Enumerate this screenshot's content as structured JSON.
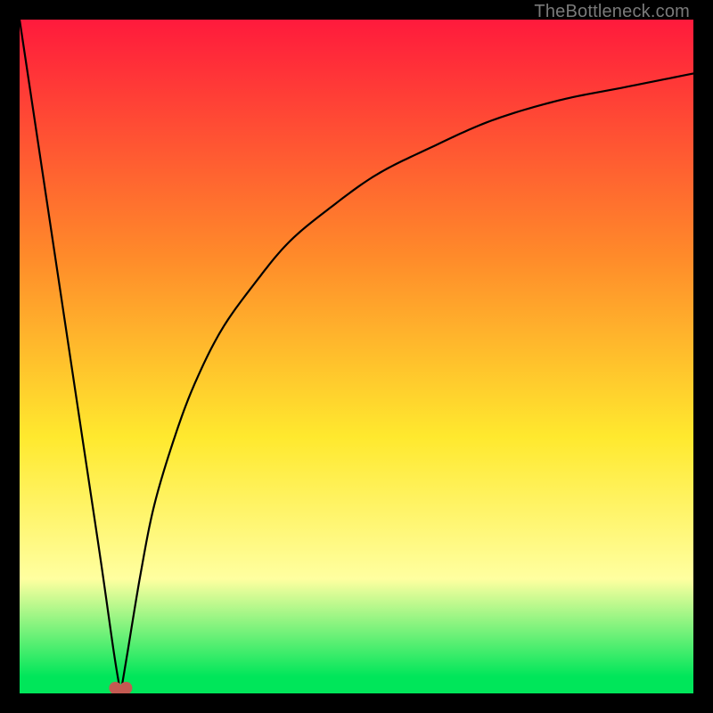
{
  "attribution": "TheBottleneck.com",
  "colors": {
    "red": "#ff1a3c",
    "orange": "#ff8a2a",
    "yellow": "#ffe92e",
    "paleyellow": "#ffffa0",
    "green": "#00e65a",
    "black": "#000000",
    "curve": "#000000",
    "minmarker": "#c45a52"
  },
  "chart_data": {
    "type": "line",
    "title": "",
    "xlabel": "",
    "ylabel": "",
    "xlim": [
      0,
      100
    ],
    "ylim": [
      0,
      100
    ],
    "x_at_min": 15,
    "y_at_min": 0,
    "y_at_x0": 100,
    "y_at_x100": 92,
    "series": [
      {
        "name": "bottleneck-curve",
        "x": [
          0,
          3,
          6,
          9,
          12,
          14,
          15,
          16,
          18,
          20,
          23,
          26,
          30,
          35,
          40,
          46,
          53,
          61,
          70,
          80,
          90,
          100
        ],
        "y": [
          100,
          80,
          60,
          40,
          20,
          6,
          0,
          6,
          18,
          28,
          38,
          46,
          54,
          61,
          67,
          72,
          77,
          81,
          85,
          88,
          90,
          92
        ]
      }
    ],
    "min_marker": {
      "x": 15,
      "y": 0,
      "shape": "heart",
      "color_key": "minmarker"
    },
    "gradient_stops": [
      {
        "offset": 0.0,
        "color_key": "red"
      },
      {
        "offset": 0.35,
        "color_key": "orange"
      },
      {
        "offset": 0.62,
        "color_key": "yellow"
      },
      {
        "offset": 0.83,
        "color_key": "paleyellow"
      },
      {
        "offset": 0.975,
        "color_key": "green"
      },
      {
        "offset": 1.0,
        "color_key": "green"
      }
    ]
  }
}
